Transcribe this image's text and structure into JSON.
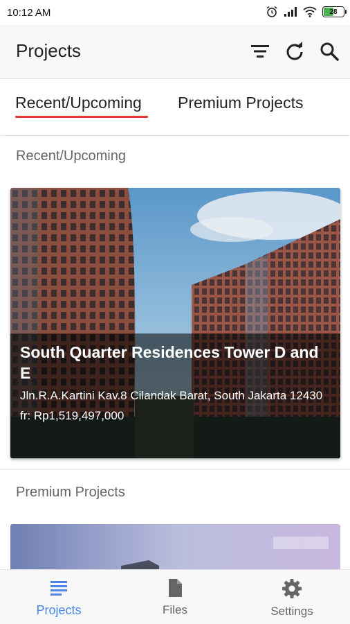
{
  "status_bar": {
    "time": "10:12 AM",
    "battery": "28"
  },
  "app_bar": {
    "title": "Projects",
    "actions": [
      "filter-icon",
      "refresh-icon",
      "search-icon"
    ]
  },
  "tabs": [
    {
      "label": "Recent/Upcoming",
      "selected": true
    },
    {
      "label": "Premium Projects",
      "selected": false
    }
  ],
  "sections": [
    {
      "title": "Recent/Upcoming",
      "cards": [
        {
          "title": "South Quarter Residences Tower D and E",
          "address": "Jln.R.A.Kartini Kav.8 Cilandak Barat, South Jakarta 12430",
          "price": "fr: Rp1,519,497,000"
        }
      ]
    },
    {
      "title": "Premium Projects"
    }
  ],
  "bottom_nav": [
    {
      "label": "Projects",
      "icon": "list-icon",
      "active": true
    },
    {
      "label": "Files",
      "icon": "file-icon",
      "active": false
    },
    {
      "label": "Settings",
      "icon": "gear-icon",
      "active": false
    }
  ],
  "colors": {
    "accent": "#4a86e8",
    "tab_indicator": "#e53935"
  }
}
